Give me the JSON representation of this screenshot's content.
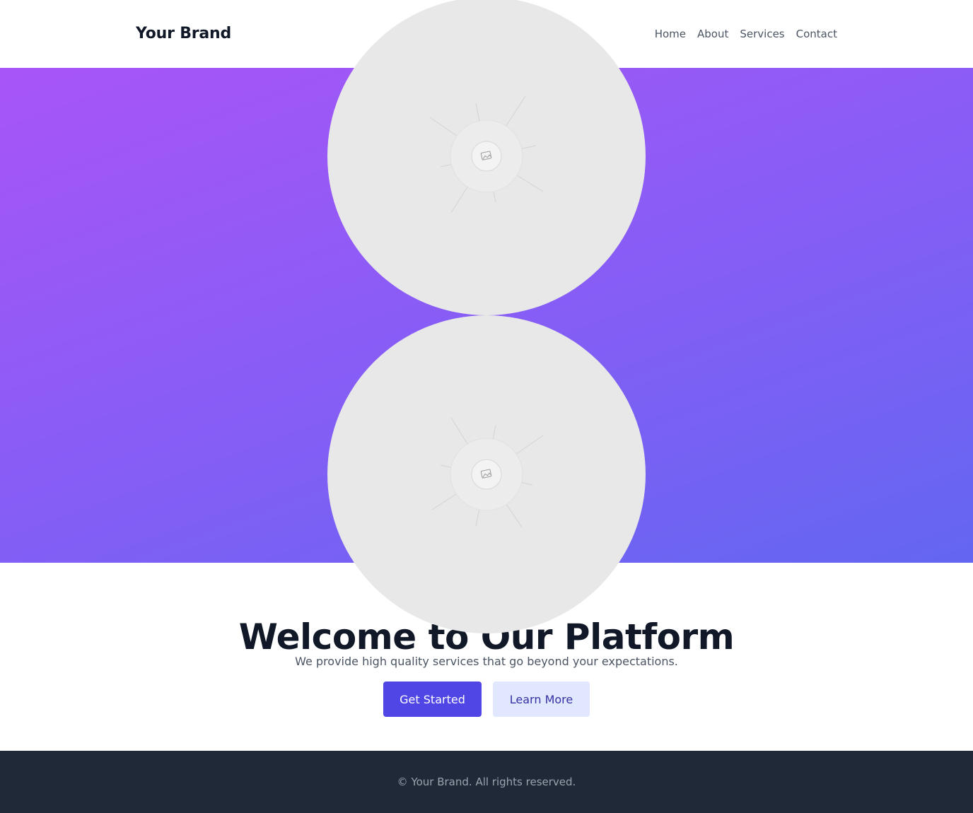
{
  "header": {
    "brand": "Your Brand",
    "nav": [
      "Home",
      "About",
      "Services",
      "Contact"
    ]
  },
  "hero": {
    "gradient_colors": [
      "#a855f7",
      "#6366f1"
    ],
    "images": [
      {
        "icon": "image-placeholder-icon"
      },
      {
        "icon": "image-placeholder-icon"
      }
    ]
  },
  "main": {
    "headline": "Welcome to Our Platform",
    "subtext": "We provide high quality services that go beyond your expectations.",
    "primary_button": "Get Started",
    "secondary_button": "Learn More"
  },
  "footer": {
    "copyright": "© Your Brand. All rights reserved."
  },
  "colors": {
    "accent": "#4f46e5",
    "accent_light": "#e0e7ff",
    "footer_bg": "#1f2937",
    "placeholder_bg": "#e8e8e8"
  }
}
